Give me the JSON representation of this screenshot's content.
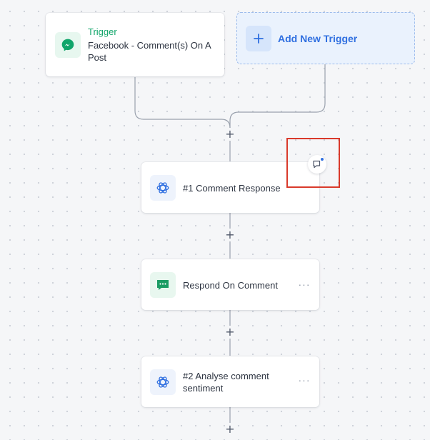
{
  "trigger": {
    "title": "Trigger",
    "description": "Facebook - Comment(s) On A Post",
    "icon": "messenger-icon"
  },
  "add_trigger": {
    "label": "Add New Trigger",
    "icon": "plus-icon"
  },
  "add_step": {
    "symbol": "+"
  },
  "steps": [
    {
      "label": "#1 Comment Response",
      "icon": "openai-icon"
    },
    {
      "label": "Respond On Comment",
      "icon": "chat-bubble-icon"
    },
    {
      "label": "#2 Analyse comment sentiment",
      "icon": "openai-icon"
    }
  ],
  "more_symbol": "···",
  "colors": {
    "trigger_green": "#10a56a",
    "add_trigger_blue": "#2f6fe0",
    "add_trigger_bg": "#eaf2fd",
    "openai_blue": "#2f6fe0",
    "openai_bg": "#eef3fc",
    "respond_green": "#1a9c63",
    "respond_bg": "#e8f7ef",
    "highlight_red": "#d93a2b"
  }
}
